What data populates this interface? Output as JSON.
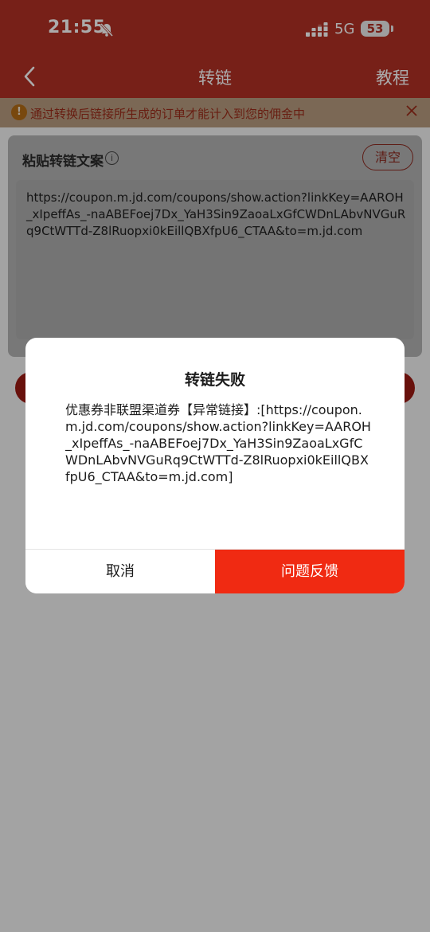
{
  "status_bar": {
    "time": "21:55",
    "network": "5G",
    "battery": "53"
  },
  "nav": {
    "title": "转链",
    "right_action": "教程"
  },
  "notice": {
    "text": "通过转换后链接所生成的订单才能计入到您的佣金中",
    "icon": "!"
  },
  "card": {
    "label": "粘贴转链文案",
    "info_icon": "i",
    "clear_button": "清空",
    "text": "https://coupon.m.jd.com/coupons/show.action?linkKey=AAROH_xIpeffAs_-naABEFoej7Dx_YaH3Sin9ZaoaLxGfCWDnLAbvNVGuRq9CtWTTd-Z8lRuopxi0kEillQBXfpU6_CTAA&to=m.jd.com"
  },
  "dialog": {
    "title": "转链失败",
    "message": "优惠券非联盟渠道券【异常链接】:[https://coupon.m.jd.com/coupons/show.action?linkKey=AAROH_xIpeffAs_-naABEFoej7Dx_YaH3Sin9ZaoaLxGfCWDnLAbvNVGuRq9CtWTTd-Z8lRuopxi0kEillQBXfpU6_CTAA&to=m.jd.com]",
    "cancel": "取消",
    "feedback": "问题反馈"
  },
  "colors": {
    "header_red": "#e23b2c",
    "accent_red": "#f02a12",
    "overlay": "rgba(0,0,0,0.33)"
  }
}
